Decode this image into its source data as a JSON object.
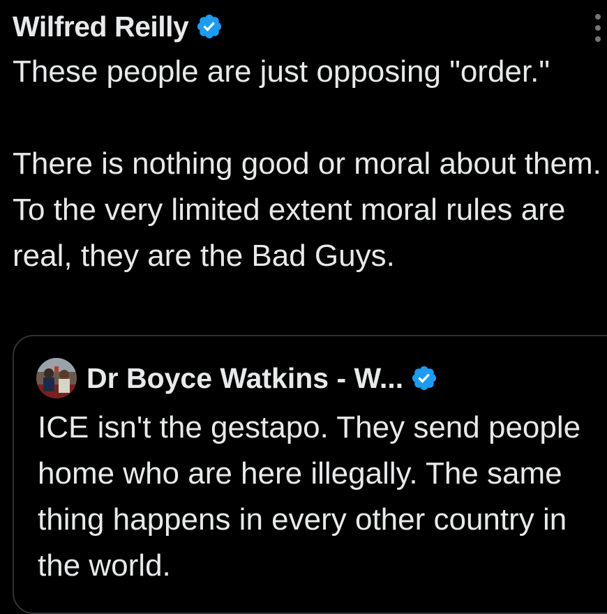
{
  "tweet": {
    "author_name": "Wilfred Reilly",
    "verified_icon": "verified-badge-icon",
    "more_icon": "more-options-icon",
    "text": "These people are just opposing \"order.\"\n\nThere is nothing good or moral about them. To the very limited extent moral rules are real, they are the Bad Guys."
  },
  "quote": {
    "author_name": "Dr Boyce Watkins - W...",
    "verified_icon": "verified-badge-icon",
    "avatar_icon": "profile-photo-avatar",
    "text": "ICE isn't the gestapo.  They send people home who are here illegally. The same thing happens in every other country in the world."
  },
  "colors": {
    "background": "#000000",
    "text": "#e7e9ea",
    "verified_blue": "#1d9bf0",
    "border": "#2f3336",
    "muted": "#71767b"
  }
}
